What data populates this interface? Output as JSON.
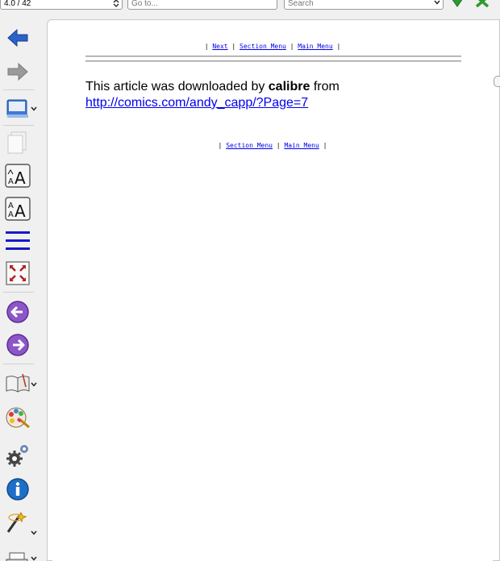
{
  "toolbar": {
    "position": "4.0 / 42",
    "goto_placeholder": "Go to...",
    "search_placeholder": "Search"
  },
  "sidebar": {
    "tools": [
      {
        "name": "back-icon",
        "color": "#2a62c9"
      },
      {
        "name": "forward-icon",
        "color": "#8a8a8a"
      },
      {
        "name": "bookmarks-icon"
      },
      {
        "name": "copy-icon"
      },
      {
        "name": "font-size-larger-icon"
      },
      {
        "name": "font-size-smaller-icon"
      },
      {
        "name": "toc-icon",
        "color": "#1818c8"
      },
      {
        "name": "fullscreen-icon",
        "color": "#b22222"
      },
      {
        "name": "previous-page-icon",
        "color": "#7a45b8"
      },
      {
        "name": "next-page-icon",
        "color": "#7a45b8"
      },
      {
        "name": "reference-mode-icon"
      },
      {
        "name": "theme-icon"
      },
      {
        "name": "preferences-icon"
      },
      {
        "name": "metadata-icon",
        "color": "#1e6fc8"
      },
      {
        "name": "lookup-icon"
      },
      {
        "name": "print-icon"
      }
    ]
  },
  "content": {
    "nav_top": {
      "next": "Next",
      "section_menu": "Section Menu",
      "main_menu": "Main Menu"
    },
    "article_prefix": "This article was downloaded by ",
    "article_brand": "calibre",
    "article_suffix": " from",
    "article_url": "http://comics.com/andy_capp/?Page=7",
    "nav_bottom": {
      "section_menu": "Section Menu",
      "main_menu": "Main Menu"
    }
  }
}
